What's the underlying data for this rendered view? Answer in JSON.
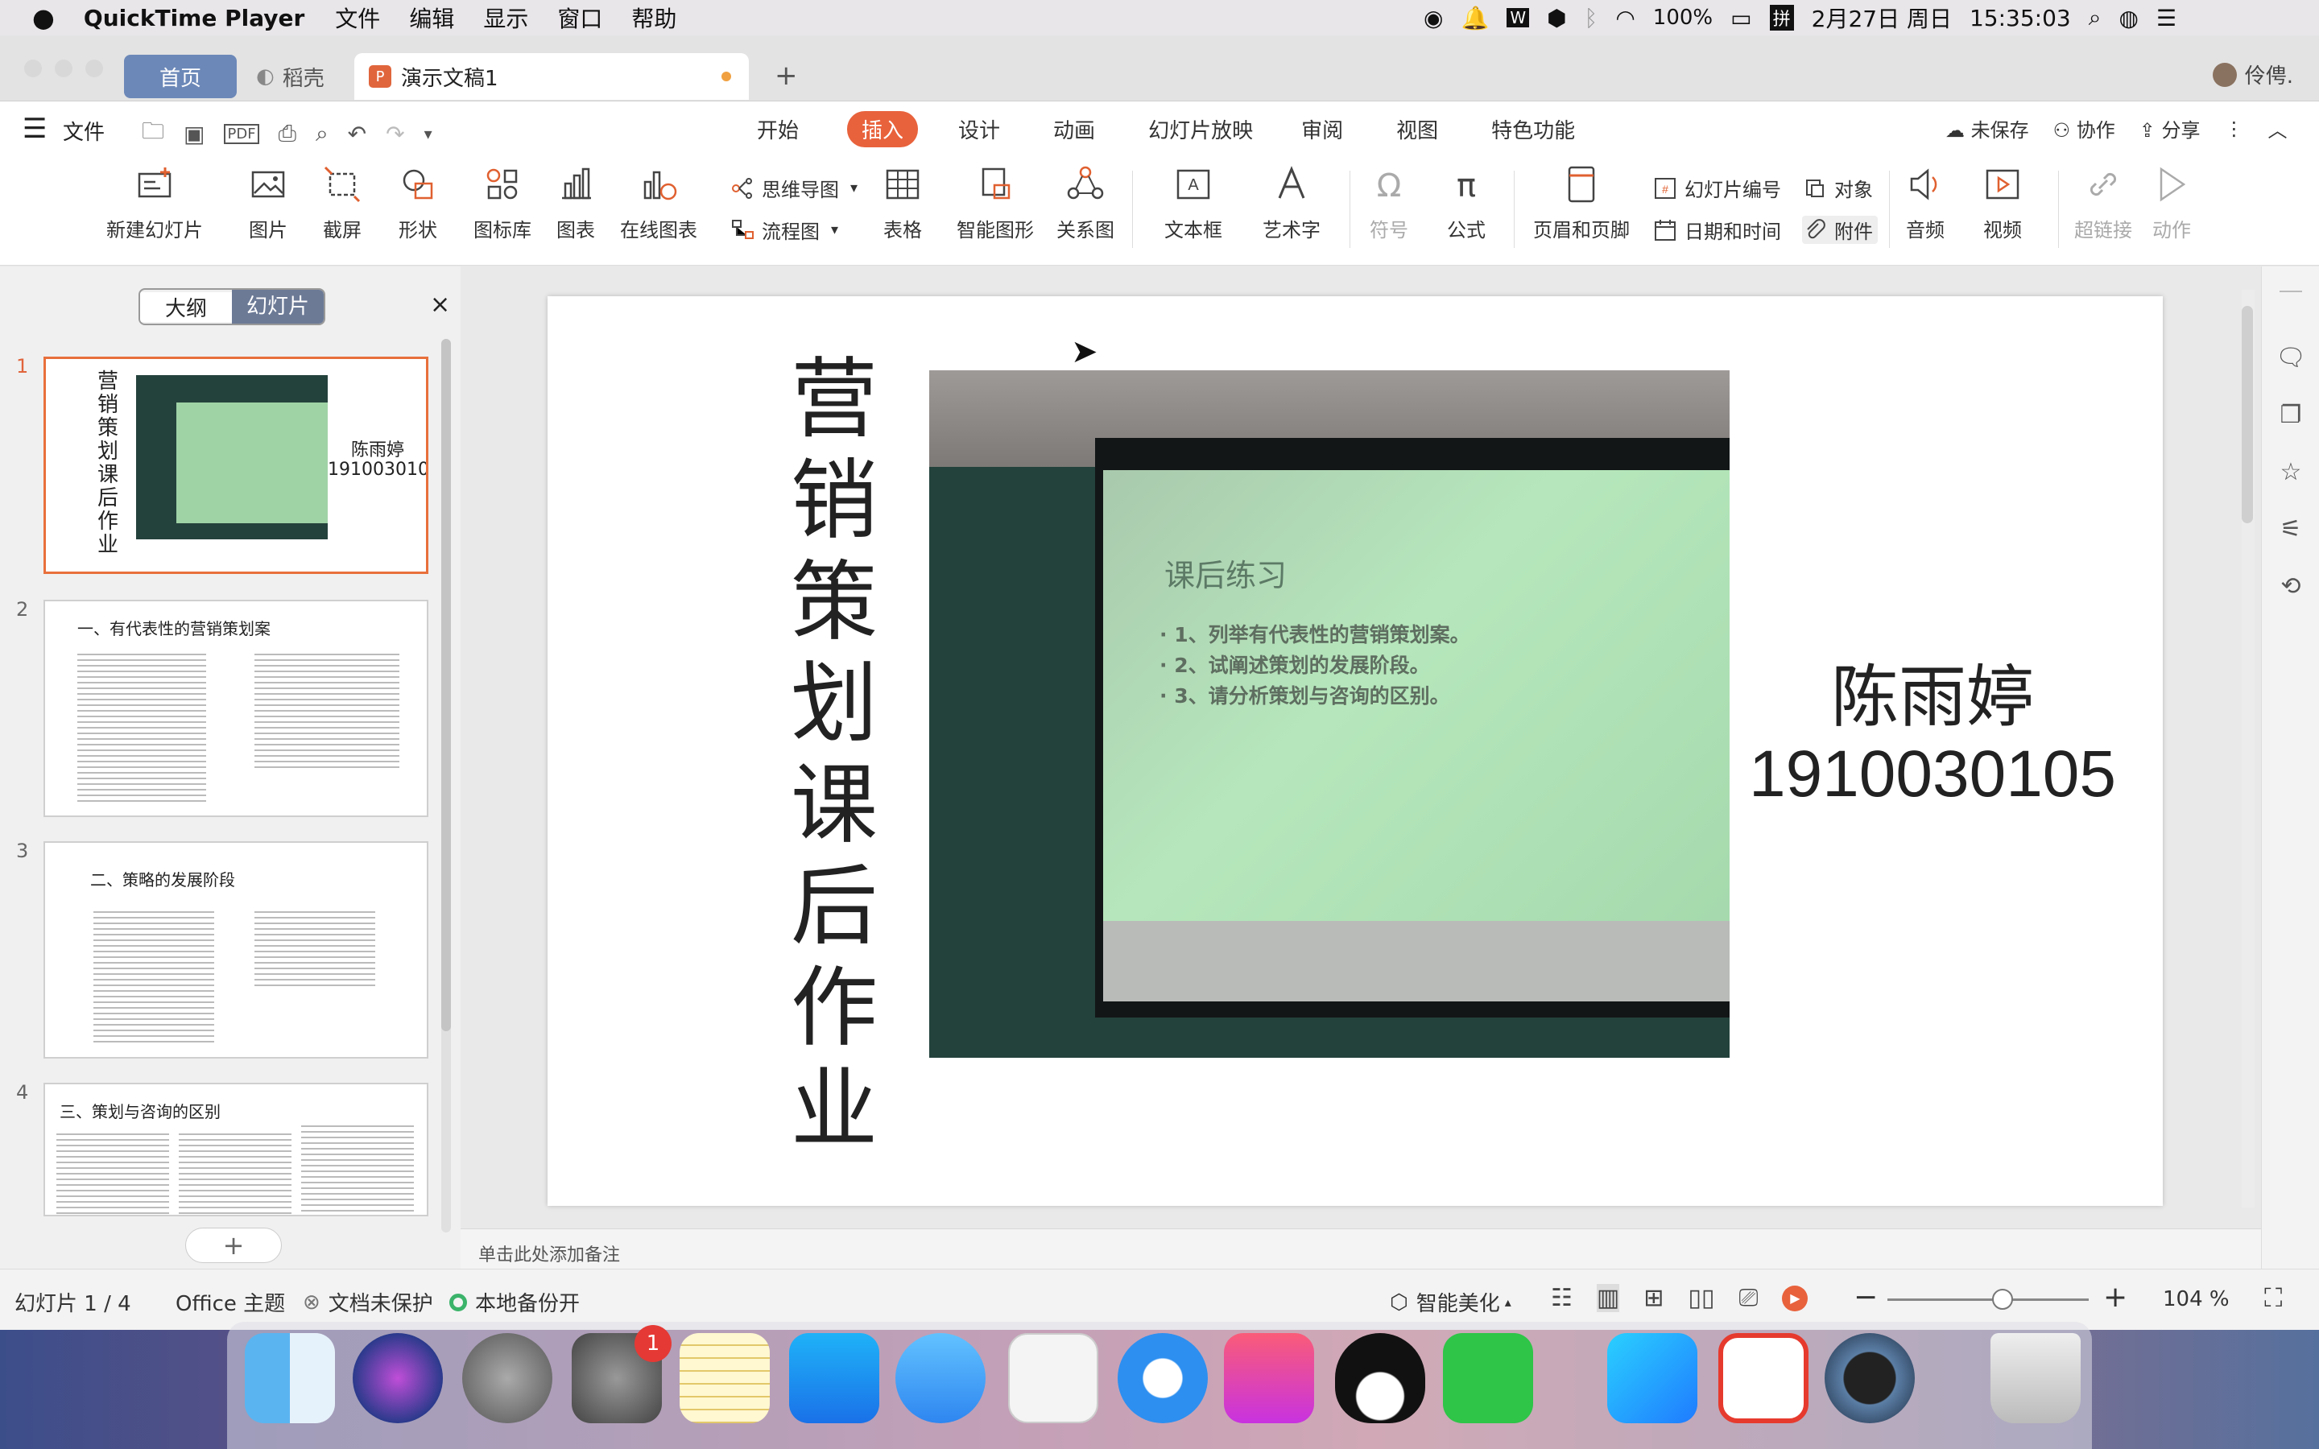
{
  "menubar": {
    "app": "QuickTime Player",
    "items": [
      "文件",
      "编辑",
      "显示",
      "窗口",
      "帮助"
    ],
    "battery": "100%",
    "input": "拼",
    "date": "2月27日 周日",
    "time": "15:35:03"
  },
  "tabs": {
    "home": "首页",
    "daoke": "稻壳",
    "doc": "演示文稿1",
    "user": "伶俜."
  },
  "menurow": {
    "file": "文件",
    "tabs": [
      "开始",
      "插入",
      "设计",
      "动画",
      "幻灯片放映",
      "审阅",
      "视图",
      "特色功能"
    ],
    "active": "插入",
    "unsaved": "未保存",
    "collab": "协作",
    "share": "分享"
  },
  "ribbon": {
    "new_slide": "新建幻灯片",
    "picture": "图片",
    "screenshot": "截屏",
    "shape": "形状",
    "icon_lib": "图标库",
    "chart": "图表",
    "online_chart": "在线图表",
    "mindmap": "思维导图",
    "flowchart": "流程图",
    "table": "表格",
    "smartart": "智能图形",
    "relation": "关系图",
    "textbox": "文本框",
    "wordart": "艺术字",
    "symbol": "符号",
    "formula": "公式",
    "header_footer": "页眉和页脚",
    "slide_number": "幻灯片编号",
    "datetime": "日期和时间",
    "object": "对象",
    "attachment": "附件",
    "audio": "音频",
    "video": "视频",
    "hyperlink": "超链接",
    "action": "动作"
  },
  "panel": {
    "outline": "大纲",
    "slides": "幻灯片",
    "thumbs": [
      {
        "num": "1"
      },
      {
        "num": "2",
        "title": "一、有代表性的营销策划案"
      },
      {
        "num": "3",
        "title": "二、策略的发展阶段"
      },
      {
        "num": "4",
        "title": "三、策划与咨询的区别"
      }
    ]
  },
  "slide": {
    "title_chars": [
      "营",
      "销",
      "策",
      "划",
      "课",
      "后",
      "作",
      "业"
    ],
    "name": "陈雨婷",
    "id": "1910030105",
    "photo_heading": "课后练习",
    "photo_items": [
      "· 1、列举有代表性的营销策划案。",
      "· 2、试阐述策划的发展阶段。",
      "· 3、请分析策划与咨询的区别。"
    ]
  },
  "notes_placeholder": "单击此处添加备注",
  "status": {
    "slide_pos": "幻灯片 1 / 4",
    "theme": "Office 主题",
    "protect": "文档未保护",
    "backup": "本地备份开",
    "beautify": "智能美化",
    "zoom": "104 %"
  },
  "dock": {
    "badge": "1"
  }
}
